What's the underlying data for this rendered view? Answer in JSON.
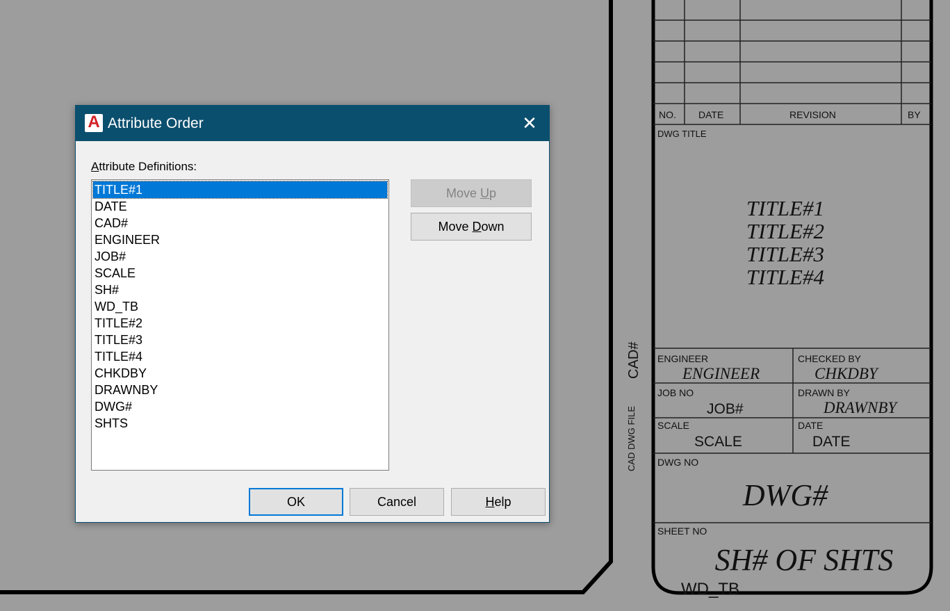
{
  "dialog": {
    "title": "Attribute Order",
    "app_icon_letter": "A",
    "close_glyph": "✕",
    "list_label": "Attribute Definitions:",
    "list_label_mnemonic": "A",
    "list_label_rest": "ttribute Definitions:",
    "attributes": [
      "TITLE#1",
      "DATE",
      "CAD#",
      "ENGINEER",
      "JOB#",
      "SCALE",
      "SH#",
      "WD_TB",
      "TITLE#2",
      "TITLE#3",
      "TITLE#4",
      "CHKDBY",
      "DRAWNBY",
      "DWG#",
      "SHTS"
    ],
    "selected_index": 0,
    "move_up": {
      "pre": "Move ",
      "mnemonic": "U",
      "post": "p",
      "enabled": false
    },
    "move_down": {
      "pre": "Move ",
      "mnemonic": "D",
      "post": "own",
      "enabled": true
    },
    "ok_label": "OK",
    "cancel_label": "Cancel",
    "help": {
      "pre": "",
      "mnemonic": "H",
      "post": "elp"
    }
  },
  "title_block": {
    "revision_headers": {
      "no": "NO.",
      "date": "DATE",
      "revision": "REVISION",
      "by": "BY"
    },
    "dwg_title_label": "DWG TITLE",
    "titles": [
      "TITLE#1",
      "TITLE#2",
      "TITLE#3",
      "TITLE#4"
    ],
    "side_cad": "CAD#",
    "side_file": "CAD DWG FILE",
    "engineer_label": "ENGINEER",
    "engineer_value": "ENGINEER",
    "checked_label": "CHECKED BY",
    "checked_value": "CHKDBY",
    "job_label": "JOB NO",
    "job_value": "JOB#",
    "drawn_label": "DRAWN BY",
    "drawn_value": "DRAWNBY",
    "scale_label": "SCALE",
    "scale_value": "SCALE",
    "date_label": "DATE",
    "date_value": "DATE",
    "dwg_no_label": "DWG NO",
    "dwg_no_value": "DWG#",
    "sheet_label": "SHEET NO",
    "sheet_value": "SH# OF SHTS",
    "wd_tb": "WD_TB"
  },
  "colors": {
    "canvas": "#9d9d9d",
    "titlebar": "#0b4f6e",
    "selection": "#0078d7",
    "autocad_red": "#d22027"
  }
}
